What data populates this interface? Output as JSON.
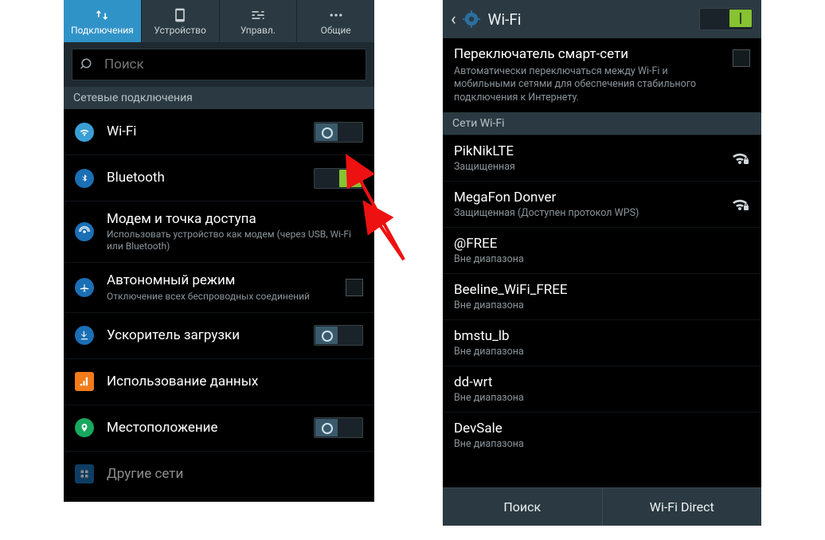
{
  "left": {
    "tabs": [
      {
        "label": "Подключения",
        "icon": "swap"
      },
      {
        "label": "Устройство",
        "icon": "device"
      },
      {
        "label": "Управл.",
        "icon": "sliders"
      },
      {
        "label": "Общие",
        "icon": "more"
      }
    ],
    "search_placeholder": "Поиск",
    "section": "Сетевые подключения",
    "items": {
      "wifi": {
        "title": "Wi-Fi"
      },
      "bluetooth": {
        "title": "Bluetooth"
      },
      "modem": {
        "title": "Модем и точка доступа",
        "sub": "Использовать устройство как модем (через USB, Wi-Fi или Bluetooth)"
      },
      "airplane": {
        "title": "Автономный режим",
        "sub": "Отключение всех беспроводных соединений"
      },
      "boost": {
        "title": "Ускоритель загрузки"
      },
      "data": {
        "title": "Использование данных"
      },
      "location": {
        "title": "Местоположение"
      },
      "other": {
        "title": "Другие сети"
      }
    }
  },
  "right": {
    "title": "Wi-Fi",
    "smart": {
      "title": "Переключатель смарт-сети",
      "desc": "Автоматически переключаться между Wi-Fi и мобильными сетями для обеспечения стабильного подключения к Интернету."
    },
    "section": "Сети Wi-Fi",
    "networks": [
      {
        "name": "PikNikLTE",
        "status": "Защищенная",
        "signal": true,
        "locked": true
      },
      {
        "name": "MegaFon Donver",
        "status": "Защищенная (Доступен протокол WPS)",
        "signal": true,
        "locked": true
      },
      {
        "name": "@FREE",
        "status": "Вне диапазона"
      },
      {
        "name": "Beeline_WiFi_FREE",
        "status": "Вне диапазона"
      },
      {
        "name": "bmstu_lb",
        "status": "Вне диапазона"
      },
      {
        "name": "dd-wrt",
        "status": "Вне диапазона"
      },
      {
        "name": "DevSale",
        "status": "Вне диапазона"
      }
    ],
    "buttons": {
      "search": "Поиск",
      "direct": "Wi-Fi Direct"
    }
  }
}
